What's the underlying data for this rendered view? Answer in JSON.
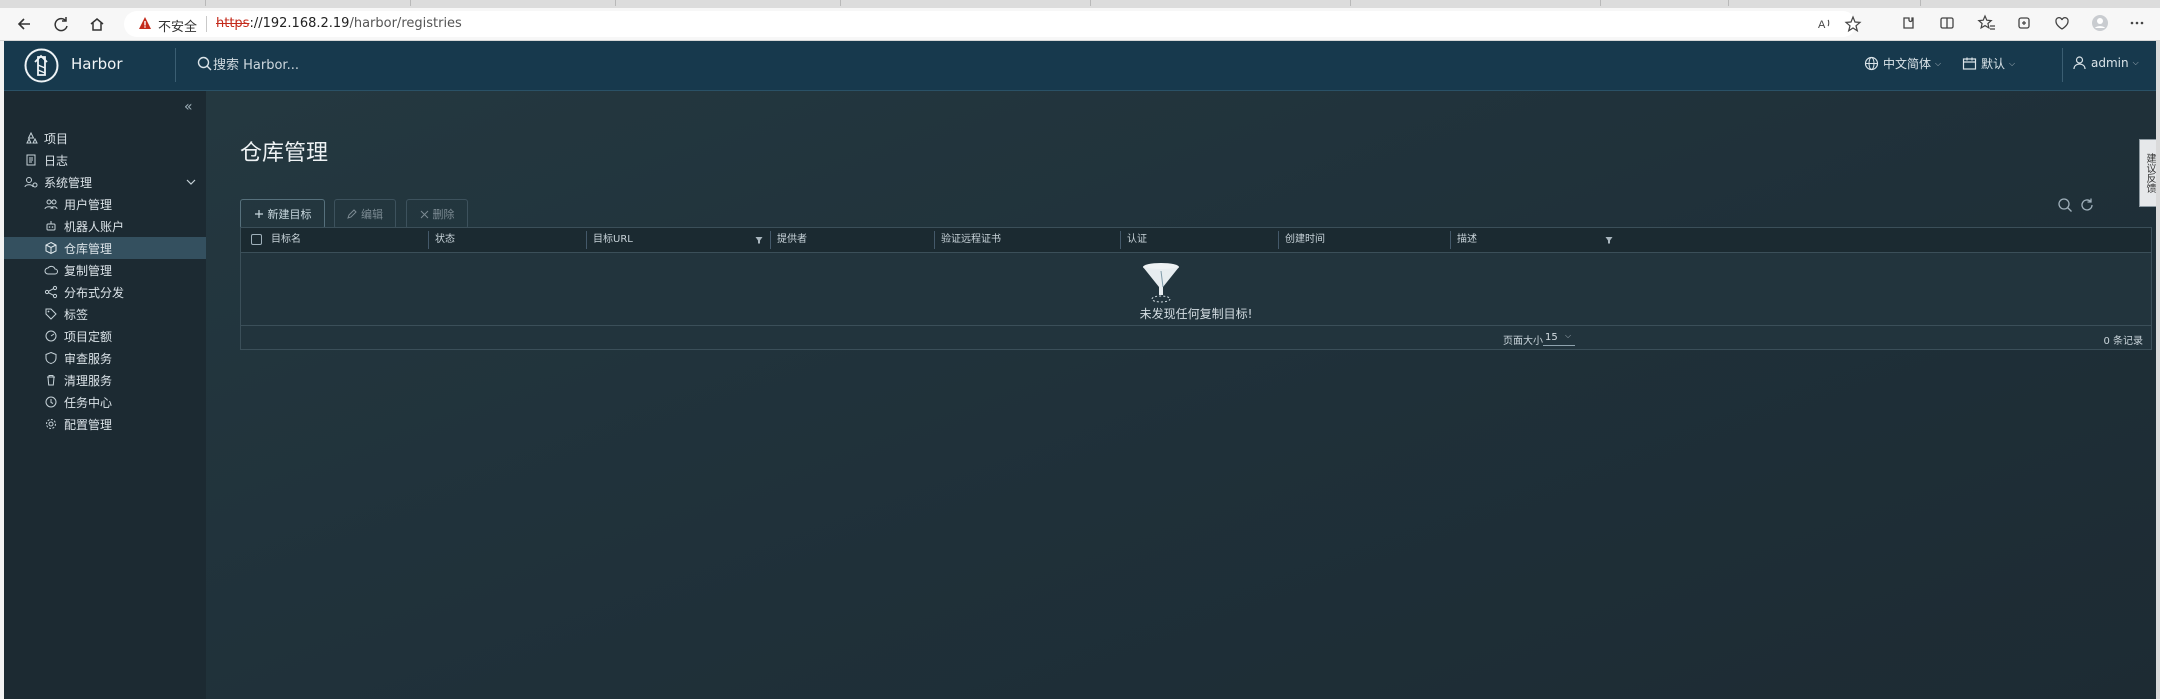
{
  "browser": {
    "security_label": "不安全",
    "url_scheme": "https",
    "url_host": "://192.168.2.19",
    "url_path": "/harbor/registries"
  },
  "header": {
    "brand": "Harbor",
    "search_placeholder": "搜索 Harbor...",
    "language": "中文简体",
    "theme": "默认",
    "user": "admin"
  },
  "sidebar": {
    "items": [
      {
        "label": "项目",
        "icon": "projects-icon"
      },
      {
        "label": "日志",
        "icon": "log-icon"
      },
      {
        "label": "系统管理",
        "icon": "admin-icon"
      },
      {
        "label": "用户管理",
        "icon": "users-icon"
      },
      {
        "label": "机器人账户",
        "icon": "robot-icon"
      },
      {
        "label": "仓库管理",
        "icon": "cube-icon"
      },
      {
        "label": "复制管理",
        "icon": "cloud-icon"
      },
      {
        "label": "分布式分发",
        "icon": "share-icon"
      },
      {
        "label": "标签",
        "icon": "tag-icon"
      },
      {
        "label": "项目定额",
        "icon": "quota-icon"
      },
      {
        "label": "审查服务",
        "icon": "shield-icon"
      },
      {
        "label": "清理服务",
        "icon": "trash-icon"
      },
      {
        "label": "任务中心",
        "icon": "clock-icon"
      },
      {
        "label": "配置管理",
        "icon": "gear-icon"
      }
    ]
  },
  "main": {
    "title": "仓库管理",
    "toolbar": {
      "new_label": "新建目标",
      "edit_label": "编辑",
      "delete_label": "删除"
    },
    "columns": [
      "目标名",
      "状态",
      "目标URL",
      "提供者",
      "验证远程证书",
      "认证",
      "创建时间",
      "描述"
    ],
    "empty_message": "未发现任何复制目标!",
    "footer": {
      "page_size_label": "页面大小",
      "page_size": "15",
      "total": "0 条记录"
    }
  },
  "side_tab": "建议反馈"
}
